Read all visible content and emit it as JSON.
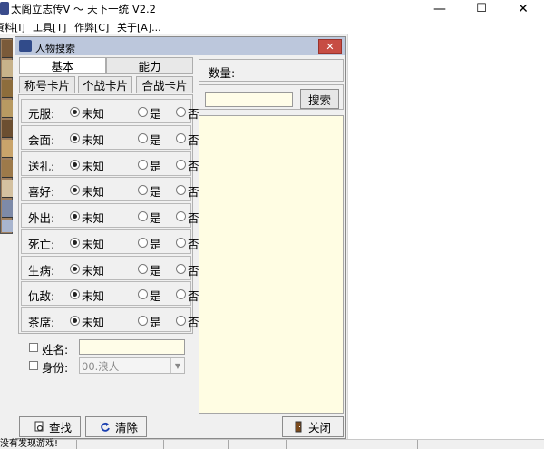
{
  "window": {
    "title": "太阁立志传V ～ 天下一统 V2.2",
    "controls": {
      "minimize": "—",
      "maximize": "☐",
      "close": "✕"
    }
  },
  "menu": [
    "資料[I]",
    "工具[T]",
    "作弊[C]",
    "关于[A]..."
  ],
  "dialog": {
    "title": "人物搜索",
    "close": "✕",
    "tabs_top": [
      "基本",
      "能力"
    ],
    "tabs_sub": [
      "称号卡片",
      "个战卡片",
      "合战卡片"
    ],
    "radio_options": [
      "未知",
      "是",
      "否"
    ],
    "rows": [
      {
        "label": "元服:",
        "selected": "未知"
      },
      {
        "label": "会面:",
        "selected": "未知"
      },
      {
        "label": "送礼:",
        "selected": "未知"
      },
      {
        "label": "喜好:",
        "selected": "未知"
      },
      {
        "label": "外出:",
        "selected": "未知"
      },
      {
        "label": "死亡:",
        "selected": "未知"
      },
      {
        "label": "生病:",
        "selected": "未知"
      },
      {
        "label": "仇敌:",
        "selected": "未知"
      },
      {
        "label": "茶席:",
        "selected": "未知"
      }
    ],
    "name_label": "姓名:",
    "name_value": "",
    "identity_label": "身份:",
    "identity_value": "00.浪人",
    "count_label": "数量:",
    "search_value": "",
    "search_button": "搜索",
    "find_button": "查找",
    "clear_button": "清除",
    "close_button": "关闭"
  },
  "status": {
    "text": "没有发现游戏!"
  },
  "colors": {
    "input_bg": "#fffde8",
    "list_bg": "#fffde3",
    "dialog_title_bg": "#bcc7dc",
    "close_btn": "#c74d44"
  }
}
